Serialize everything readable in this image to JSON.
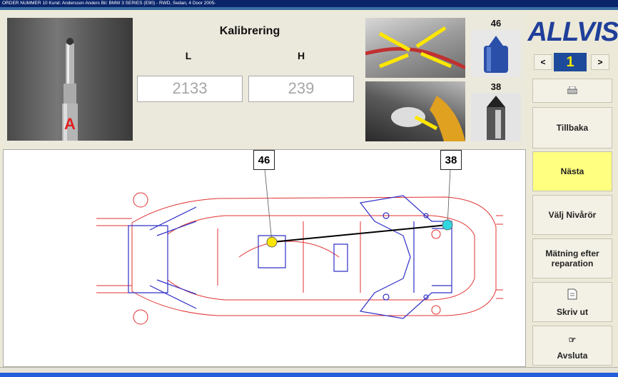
{
  "titlebar": {
    "text": "ORDER NUMMER  10    Kund: Andersson Anders    Bil: BMW   3 SERIES (E90) - RWD, Sedan, 4 Door  2005-"
  },
  "calibration": {
    "title": "Kalibrering",
    "l_label": "L",
    "h_label": "H",
    "l_value": "2133",
    "h_value": "239",
    "probe_letter": "A"
  },
  "parts": [
    {
      "number": "46"
    },
    {
      "number": "38"
    }
  ],
  "brand": {
    "logo_text": "ALLVIS",
    "color": "#1f3f9a"
  },
  "pager": {
    "prev": "<",
    "next": ">",
    "current": "1",
    "current_color": "#f5e600"
  },
  "buttons": {
    "back": "Tillbaka",
    "next": "Nästa",
    "choose_tubes": "Välj Nivårör",
    "measure_after": "Mätning efter reparation",
    "print": "Skriv ut",
    "exit": "Avsluta"
  },
  "diagram": {
    "callout_left": "46",
    "callout_right": "38",
    "point_left_color": "#ffe600",
    "point_right_color": "#2fd8e0",
    "red_outline_color": "#e03030",
    "blue_outline_color": "#3030c8"
  }
}
